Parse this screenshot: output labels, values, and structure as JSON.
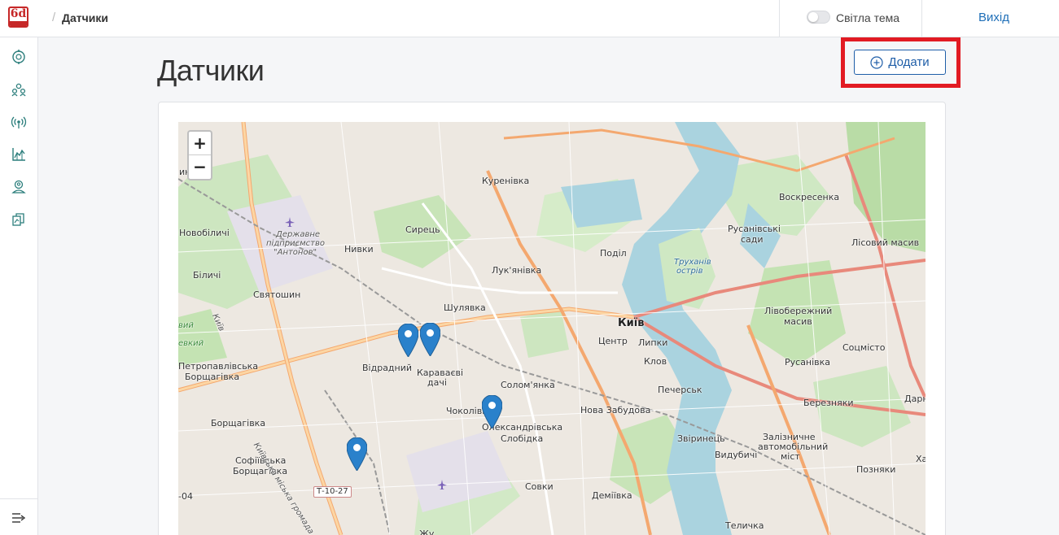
{
  "header": {
    "breadcrumb": "Датчики",
    "theme_toggle_label": "Світла тема",
    "logout_label": "Вихід"
  },
  "sidebar": {
    "items": [
      {
        "icon": "compass-icon"
      },
      {
        "icon": "users-icon"
      },
      {
        "icon": "sensor-signal-icon"
      },
      {
        "icon": "chart-icon"
      },
      {
        "icon": "location-user-icon"
      },
      {
        "icon": "reports-icon"
      }
    ],
    "collapse_icon": "collapse-menu-icon"
  },
  "page": {
    "title": "Датчики",
    "add_button_label": "Додати"
  },
  "map": {
    "zoom_in": "+",
    "zoom_out": "−",
    "labels": [
      {
        "text": "Куренівка"
      },
      {
        "text": "Воскресенка"
      },
      {
        "text": "Новобіличі"
      },
      {
        "text": "Державне"
      },
      {
        "text": "підприємство"
      },
      {
        "text": "\"Антонов\""
      },
      {
        "text": "Нивки"
      },
      {
        "text": "Сирець"
      },
      {
        "text": "Русанівські"
      },
      {
        "text": "сади"
      },
      {
        "text": "Лісовий масив"
      },
      {
        "text": "Поділ"
      },
      {
        "text": "Труханів"
      },
      {
        "text": "острів"
      },
      {
        "text": "Лук'янівка"
      },
      {
        "text": "Біличі"
      },
      {
        "text": "Святошин"
      },
      {
        "text": "Шулявка"
      },
      {
        "text": "Київ"
      },
      {
        "text": "Лівобережний"
      },
      {
        "text": "масив"
      },
      {
        "text": "Центр"
      },
      {
        "text": "Липки"
      },
      {
        "text": "Соцмісто"
      },
      {
        "text": "Відрадний"
      },
      {
        "text": "Караваєві"
      },
      {
        "text": "дачі"
      },
      {
        "text": "Клов"
      },
      {
        "text": "Русанівка"
      },
      {
        "text": "Петропавлівська"
      },
      {
        "text": "Борщагівка"
      },
      {
        "text": "Солом'янка"
      },
      {
        "text": "Печерськ"
      },
      {
        "text": "Березняки"
      },
      {
        "text": "Дарн"
      },
      {
        "text": "Чоколівка"
      },
      {
        "text": "Нова Забудова"
      },
      {
        "text": "Олександрівська"
      },
      {
        "text": "Слобідка"
      },
      {
        "text": "Борщагівка"
      },
      {
        "text": "Залізничне"
      },
      {
        "text": "автомобільний"
      },
      {
        "text": "міст"
      },
      {
        "text": "Звіринець"
      },
      {
        "text": "Видубичі"
      },
      {
        "text": "Софіївська"
      },
      {
        "text": "Борщагівка"
      },
      {
        "text": "Позняки"
      },
      {
        "text": "Совки"
      },
      {
        "text": "Деміївка"
      },
      {
        "text": "Теличка"
      },
      {
        "text": "Київська міська громада"
      },
      {
        "text": "Київ"
      },
      {
        "text": "-04"
      },
      {
        "text": "вий"
      },
      {
        "text": "евкий"
      },
      {
        "text": "ине"
      },
      {
        "text": "Жу"
      },
      {
        "text": "Ха"
      }
    ],
    "road_signs": [
      "Т-10-27"
    ],
    "markers": [
      {
        "name": "sensor-marker-1"
      },
      {
        "name": "sensor-marker-2"
      },
      {
        "name": "sensor-marker-3"
      },
      {
        "name": "sensor-marker-4"
      }
    ]
  }
}
